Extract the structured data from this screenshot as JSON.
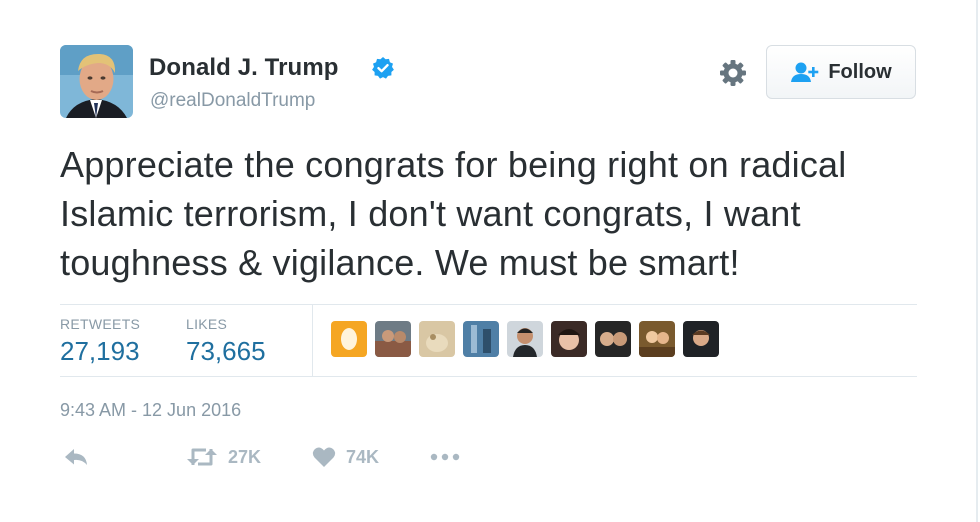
{
  "author": {
    "name": "Donald J. Trump",
    "handle": "@realDonaldTrump",
    "verified": true
  },
  "follow_button": {
    "label": "Follow"
  },
  "tweet": {
    "text": "Appreciate the congrats for being right on radical Islamic terrorism, I don't want congrats, I want toughness & vigilance. We must be smart!",
    "timestamp": "9:43 AM - 12 Jun 2016"
  },
  "stats": {
    "retweets_label": "RETWEETS",
    "retweets_value": "27,193",
    "likes_label": "LIKES",
    "likes_value": "73,665"
  },
  "actions": {
    "retweet_count": "27K",
    "like_count": "74K"
  },
  "icons": {
    "verified": "verified-badge-icon",
    "settings": "gear-icon",
    "follow": "add-user-icon",
    "reply": "reply-icon",
    "retweet": "retweet-icon",
    "like": "heart-icon",
    "more": "more-icon"
  },
  "colors": {
    "text": "#292f33",
    "muted": "#8899a6",
    "stat_value": "#1f6f9f",
    "verified": "#1da1f2",
    "action_gray": "#aab8c2",
    "follow_icon": "#1da1f2"
  }
}
